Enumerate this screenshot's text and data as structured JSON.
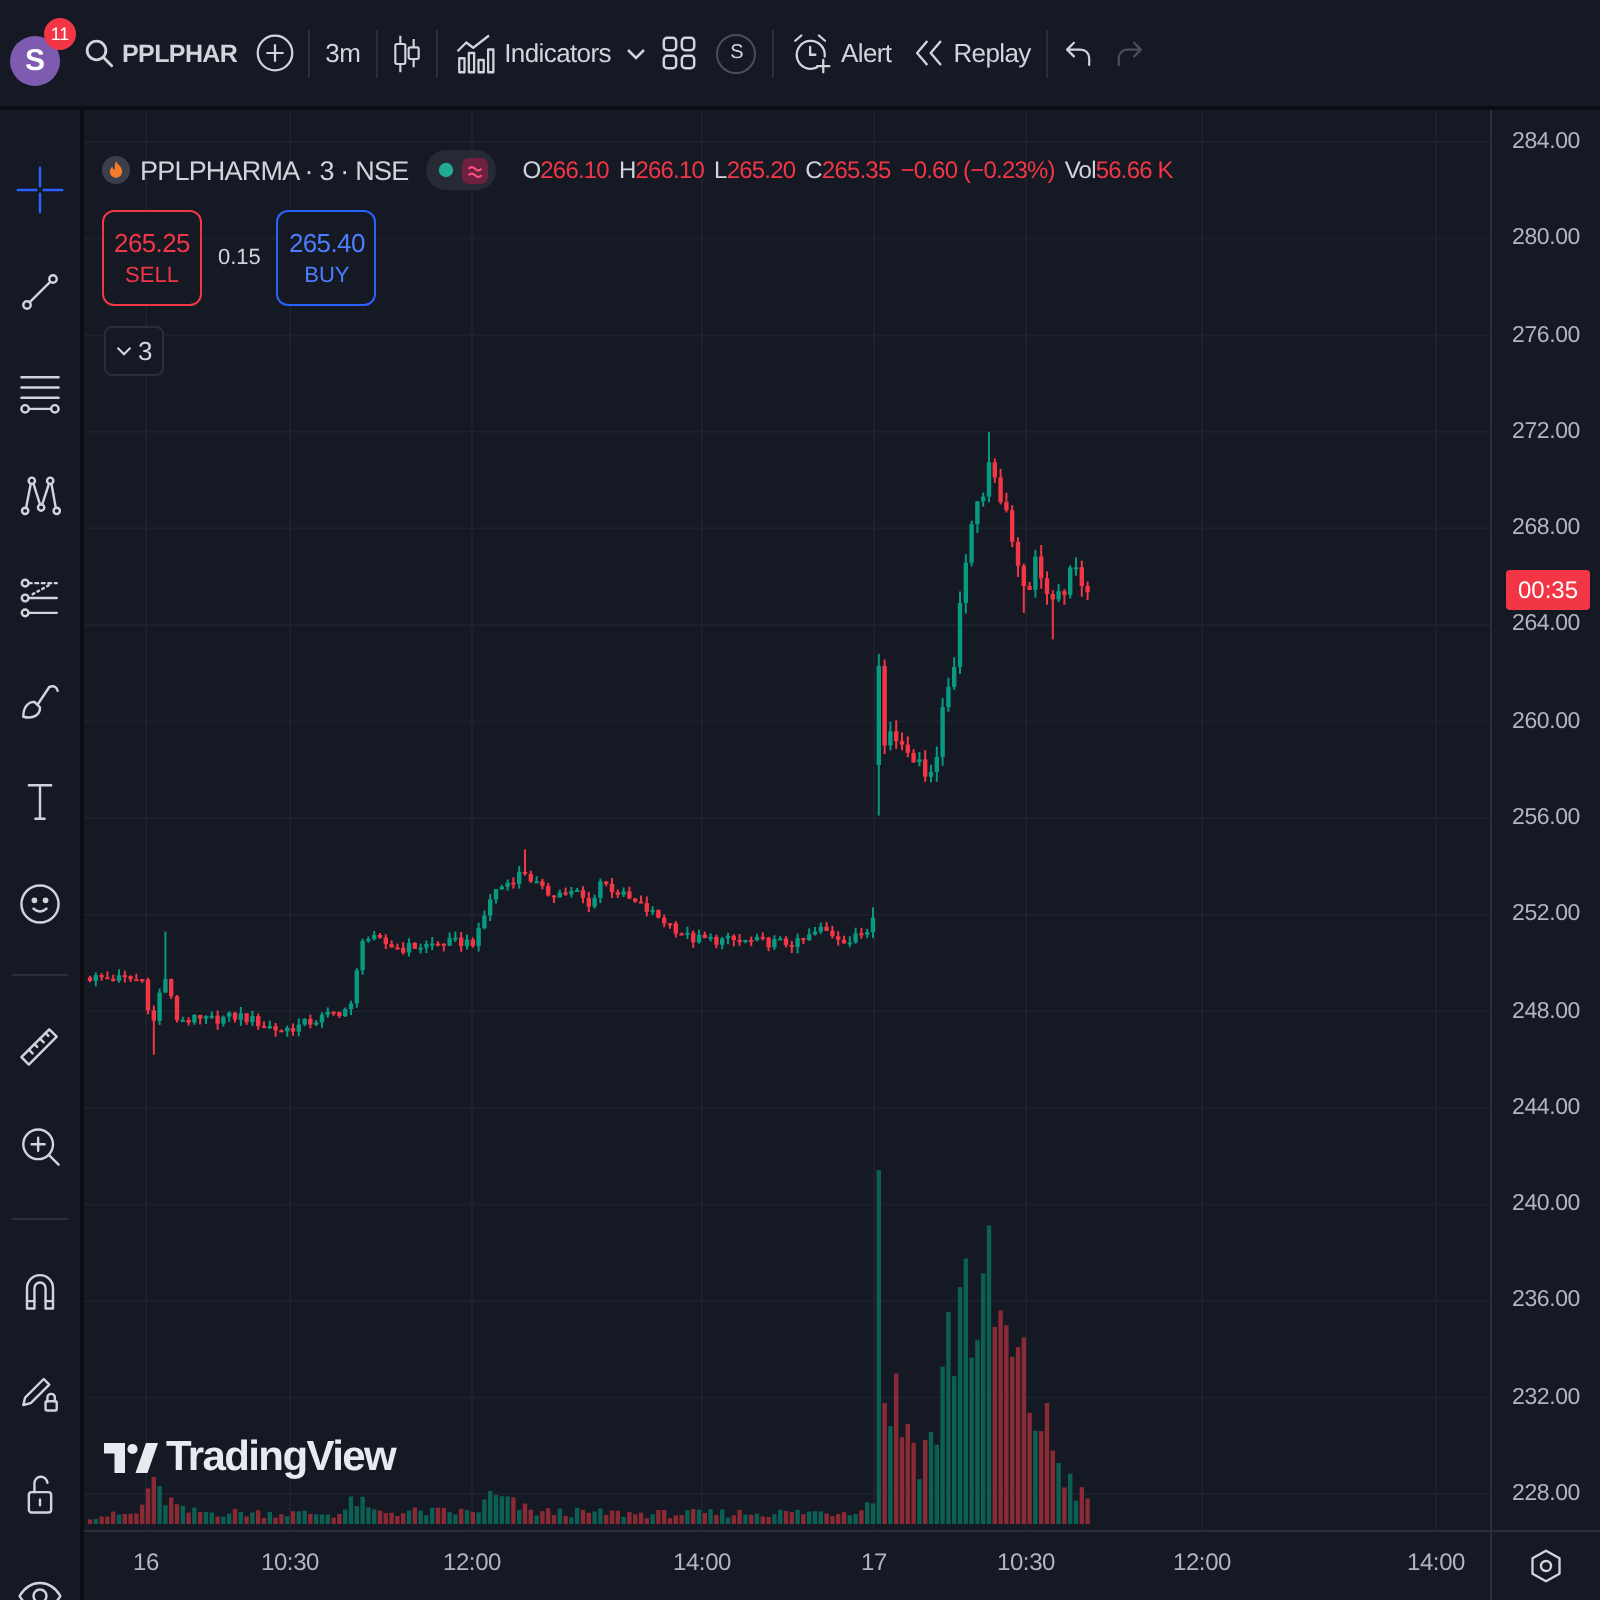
{
  "top_bar": {
    "avatar": {
      "initial": "S",
      "badge": "11"
    },
    "symbol": "PPLPHAR",
    "interval": "3m",
    "indicators_label": "Indicators",
    "circle_label": "S",
    "alert_label": "Alert",
    "replay_label": "Replay",
    "history": [
      {
        "kind": "undo",
        "disabled": false
      },
      {
        "kind": "redo",
        "disabled": true
      }
    ]
  },
  "drawing_toolbar": {
    "groups": [
      {
        "tools": [
          {
            "kind": "crosshair",
            "selected": true
          },
          {
            "kind": "trend_line",
            "selected": false
          },
          {
            "kind": "fib_levels",
            "selected": false
          },
          {
            "kind": "pattern",
            "selected": false
          },
          {
            "kind": "projection",
            "selected": false
          },
          {
            "kind": "brush",
            "selected": false
          },
          {
            "kind": "text",
            "selected": false
          },
          {
            "kind": "emoji",
            "selected": false
          }
        ]
      },
      {
        "tools": [
          {
            "kind": "ruler",
            "selected": false
          },
          {
            "kind": "zoom_in",
            "selected": false
          }
        ]
      },
      {
        "tools": [
          {
            "kind": "magnet",
            "selected": false
          },
          {
            "kind": "lock_drawing",
            "selected": false
          },
          {
            "kind": "lock",
            "selected": false
          },
          {
            "kind": "eye",
            "selected": false
          }
        ]
      }
    ]
  },
  "legend": {
    "symbol": "PPLPHARMA · 3 · NSE",
    "market_open": true,
    "falling": true,
    "ohlc": [
      {
        "label": "O",
        "value": "266.10"
      },
      {
        "label": "H",
        "value": "266.10"
      },
      {
        "label": "L",
        "value": "265.20"
      },
      {
        "label": "C",
        "value": "265.35"
      }
    ],
    "change": "−0.60 (−0.23%)",
    "volume": {
      "label": "Vol",
      "value": "56.66 K"
    }
  },
  "trade": {
    "sell": {
      "price": "265.25",
      "label": "SELL"
    },
    "spread": "0.15",
    "buy": {
      "price": "265.40",
      "label": "BUY"
    }
  },
  "indicator_toggle": {
    "count": "3"
  },
  "chart_logo": "TradingView",
  "price_axis": {
    "labels": [
      "284.00",
      "280.00",
      "276.00",
      "272.00",
      "268.00",
      "264.00",
      "260.00",
      "256.00",
      "252.00",
      "248.00",
      "244.00",
      "240.00",
      "236.00",
      "232.00",
      "228.00"
    ],
    "countdown": "00:35"
  },
  "time_axis": {
    "labels": [
      "16",
      "10:30",
      "12:00",
      "14:00",
      "17",
      "10:30",
      "12:00",
      "14:00"
    ]
  }
}
